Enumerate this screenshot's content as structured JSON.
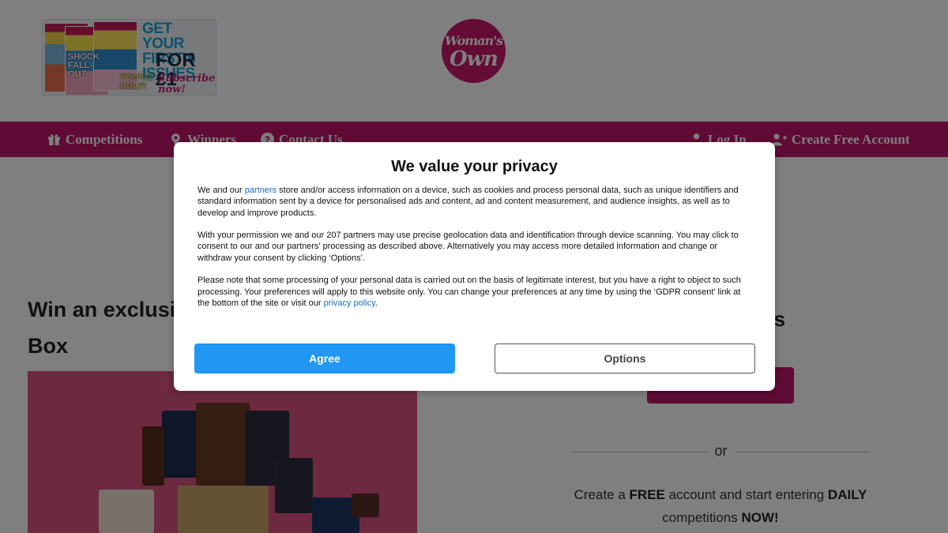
{
  "header": {
    "promo": {
      "headline": "GET YOUR FIRST 6 ISSUES",
      "price": "FOR £1",
      "subscribe": "Subscribe now!",
      "cover_text_1": "SHOCK FALL-OUT",
      "cover_text_2": "YOU'RE UGLY!"
    },
    "logo": {
      "line1": "Woman's",
      "line2": "Own"
    }
  },
  "nav": {
    "left": [
      {
        "label": "Competitions",
        "icon": "gift-icon"
      },
      {
        "label": "Winners",
        "icon": "trophy-icon"
      },
      {
        "label": "Contact Us",
        "icon": "question-icon"
      }
    ],
    "right": [
      {
        "label": "Log In",
        "icon": "user-icon"
      },
      {
        "label": "Create Free Account",
        "icon": "user-plus-icon"
      }
    ]
  },
  "main": {
    "prize_title_line1": "Win an exclusi",
    "prize_title_line2": "Box",
    "side_heading": "ers",
    "or_text": "or",
    "cta_parts": [
      "Create a ",
      "FREE",
      " account and start entering ",
      "DAILY",
      " competitions ",
      "NOW!"
    ]
  },
  "consent": {
    "title": "We value your privacy",
    "p1_before": "We and our ",
    "p1_link": "partners",
    "p1_after": " store and/or access information on a device, such as cookies and process personal data, such as unique identifiers and standard information sent by a device for personalised ads and content, ad and content measurement, and audience insights, as well as to develop and improve products.",
    "p2": "With your permission we and our 207 partners may use precise geolocation data and identification through device scanning. You may click to consent to our and our partners' processing as described above. Alternatively you may access more detailed information and change or withdraw your consent by clicking ‘Options’.",
    "p3_before": "Please note that some processing of your personal data is carried out on the basis of legitimate interest, but you have a right to object to such processing. Your preferences will apply to this website only. You can change your preferences at any time by using the ‘GDPR consent’ link at the bottom of the site or visit our ",
    "p3_link": "privacy policy",
    "p3_after": ".",
    "agree_label": "Agree",
    "options_label": "Options"
  },
  "colors": {
    "brand": "#c0176d",
    "agree": "#2196f3",
    "link": "#1a6fc4"
  }
}
